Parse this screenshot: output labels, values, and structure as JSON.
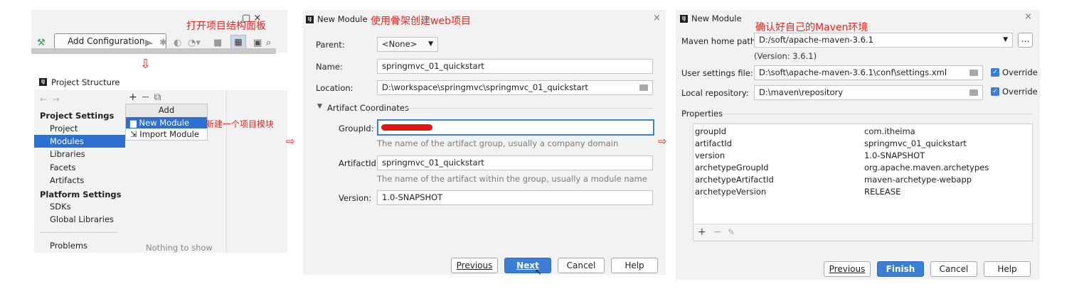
{
  "toolbar": {
    "add_configuration_label": "Add Configuration...",
    "annotation": "打开项目结构面板",
    "icons": [
      "hammer-icon",
      "run-icon",
      "debug-icon",
      "coverage-icon",
      "profile-icon",
      "stop-icon",
      "project-structure-icon",
      "search-icon"
    ]
  },
  "project_structure": {
    "title": "Project Structure",
    "project_settings_header": "Project Settings",
    "project_settings_items": [
      "Project",
      "Modules",
      "Libraries",
      "Facets",
      "Artifacts"
    ],
    "selected_item": "Modules",
    "platform_settings_header": "Platform Settings",
    "platform_settings_items": [
      "SDKs",
      "Global Libraries"
    ],
    "problems_label": "Problems",
    "empty_text": "Nothing to show",
    "add_menu": {
      "header": "Add",
      "items": [
        "New Module",
        "Import Module"
      ]
    },
    "annotation": "新建一个项目模块"
  },
  "new_module_1": {
    "title": "New Module",
    "annotation": "使用骨架创建web项目",
    "parent_label": "Parent:",
    "parent_value": "<None>",
    "name_label": "Name:",
    "name_value": "springmvc_01_quickstart",
    "location_label": "Location:",
    "location_value": "D:\\workspace\\springmvc\\springmvc_01_quickstart",
    "artifact_coordinates_label": "Artifact Coordinates",
    "groupid_label": "GroupId:",
    "groupid_hint": "The name of the artifact group, usually a company domain",
    "artifactid_label": "ArtifactId:",
    "artifactid_value": "springmvc_01_quickstart",
    "artifactid_hint": "The name of the artifact within the group, usually a module name",
    "version_label": "Version:",
    "version_value": "1.0-SNAPSHOT",
    "buttons": {
      "previous": "Previous",
      "next": "Next",
      "cancel": "Cancel",
      "help": "Help"
    }
  },
  "new_module_2": {
    "title": "New Module",
    "annotation": "确认好自己的Maven环境",
    "maven_home_label": "Maven home path:",
    "maven_home_value": "D:/soft/apache-maven-3.6.1",
    "maven_version": "(Version: 3.6.1)",
    "user_settings_label": "User settings file:",
    "user_settings_value": "D:\\soft\\apache-maven-3.6.1\\conf\\settings.xml",
    "local_repo_label": "Local repository:",
    "local_repo_value": "D:\\maven\\repository",
    "override_label": "Override",
    "properties_label": "Properties",
    "properties": [
      {
        "key": "groupId",
        "value": "com.itheima"
      },
      {
        "key": "artifactId",
        "value": "springmvc_01_quickstart"
      },
      {
        "key": "version",
        "value": "1.0-SNAPSHOT"
      },
      {
        "key": "archetypeGroupId",
        "value": "org.apache.maven.archetypes"
      },
      {
        "key": "archetypeArtifactId",
        "value": "maven-archetype-webapp"
      },
      {
        "key": "archetypeVersion",
        "value": "RELEASE"
      }
    ],
    "buttons": {
      "previous": "Previous",
      "finish": "Finish",
      "cancel": "Cancel",
      "help": "Help"
    }
  },
  "colors": {
    "annotation_red": "#e8261f",
    "selection_blue": "#2e70d0",
    "primary_button": "#3b7ed6"
  }
}
